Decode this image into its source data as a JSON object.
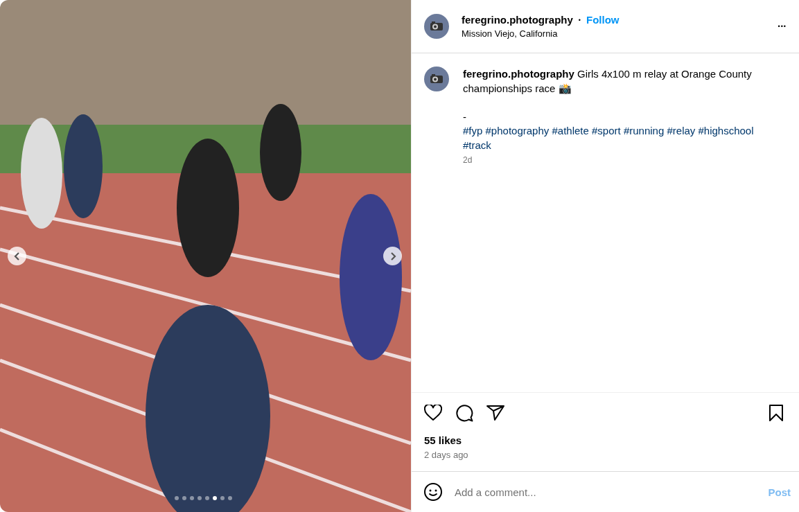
{
  "media": {
    "dots": [
      {
        "selected": false
      },
      {
        "selected": false
      },
      {
        "selected": false
      },
      {
        "selected": false
      },
      {
        "selected": false
      },
      {
        "selected": true
      },
      {
        "selected": false
      },
      {
        "selected": false
      }
    ]
  },
  "header": {
    "username": "feregrino.photography",
    "separator": "•",
    "follow": "Follow",
    "location": "Mission Viejo, California",
    "more": "•••"
  },
  "caption": {
    "username": "feregrino.photography",
    "text": "Girls 4x100 m relay at Orange County championships race 📸",
    "dash": "-",
    "hashtags": [
      "#fyp",
      "#photography",
      "#athlete",
      "#sport",
      "#running",
      "#relay",
      "#highschool",
      "#track"
    ],
    "time": "2d"
  },
  "likes": "55 likes",
  "posted": "2 days ago",
  "comment": {
    "placeholder": "Add a comment...",
    "post": "Post",
    "post_disabled": true
  }
}
